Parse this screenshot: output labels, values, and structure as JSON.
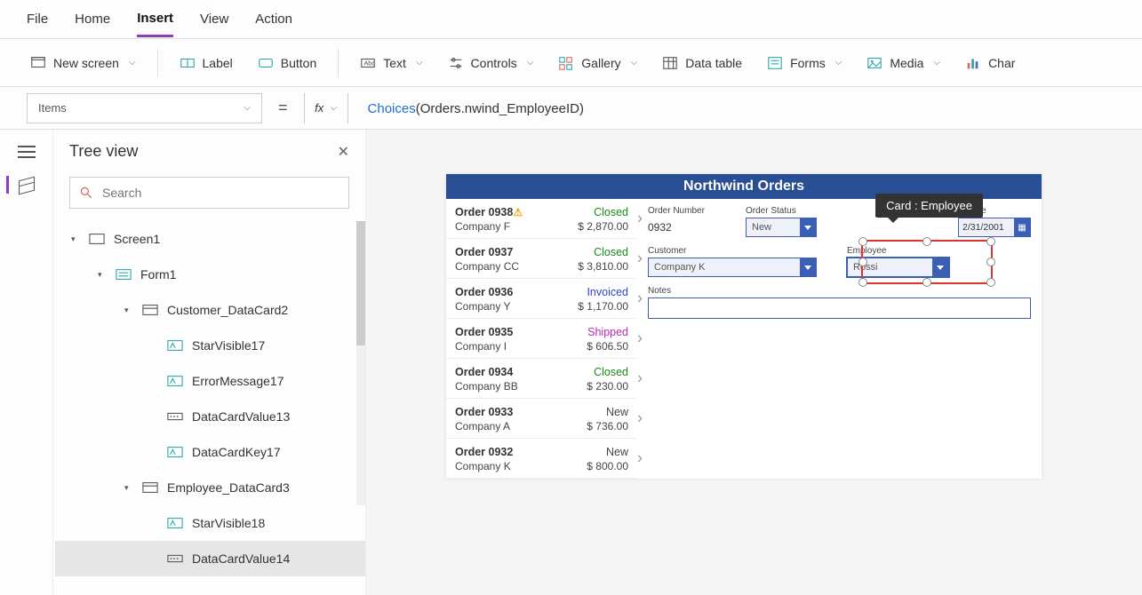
{
  "menu": {
    "file": "File",
    "home": "Home",
    "insert": "Insert",
    "view": "View",
    "action": "Action"
  },
  "ribbon": {
    "newScreen": "New screen",
    "label": "Label",
    "button": "Button",
    "text": "Text",
    "controls": "Controls",
    "gallery": "Gallery",
    "dataTable": "Data table",
    "forms": "Forms",
    "media": "Media",
    "chart": "Char"
  },
  "propertySelect": "Items",
  "formula": {
    "fn": "Choices",
    "obj": "Orders",
    "member": "nwind_EmployeeID"
  },
  "treeView": {
    "title": "Tree view",
    "searchPlaceholder": "Search",
    "nodes": {
      "screen1": "Screen1",
      "form1": "Form1",
      "customerCard": "Customer_DataCard2",
      "starVisible17": "StarVisible17",
      "errorMessage17": "ErrorMessage17",
      "dataCardValue13": "DataCardValue13",
      "dataCardKey17": "DataCardKey17",
      "employeeCard": "Employee_DataCard3",
      "starVisible18": "StarVisible18",
      "dataCardValue14": "DataCardValue14"
    }
  },
  "app": {
    "title": "Northwind Orders",
    "orders": [
      {
        "num": "Order 0938",
        "warning": true,
        "status": "Closed",
        "company": "Company F",
        "amount": "$ 2,870.00"
      },
      {
        "num": "Order 0937",
        "status": "Closed",
        "company": "Company CC",
        "amount": "$ 3,810.00"
      },
      {
        "num": "Order 0936",
        "status": "Invoiced",
        "company": "Company Y",
        "amount": "$ 1,170.00"
      },
      {
        "num": "Order 0935",
        "status": "Shipped",
        "company": "Company I",
        "amount": "$ 606.50"
      },
      {
        "num": "Order 0934",
        "status": "Closed",
        "company": "Company BB",
        "amount": "$ 230.00"
      },
      {
        "num": "Order 0933",
        "status": "New",
        "company": "Company A",
        "amount": "$ 736.00"
      },
      {
        "num": "Order 0932",
        "status": "New",
        "company": "Company K",
        "amount": "$ 800.00"
      }
    ],
    "detail": {
      "orderNumberLabel": "Order Number",
      "orderNumber": "0932",
      "orderStatusLabel": "Order Status",
      "orderStatus": "New",
      "paidDateLabel": "id Date",
      "paidDate": "2/31/2001",
      "customerLabel": "Customer",
      "customer": "Company K",
      "employeeLabel": "Employee",
      "employee": "Rossi",
      "notesLabel": "Notes"
    },
    "tooltip": "Card : Employee"
  }
}
